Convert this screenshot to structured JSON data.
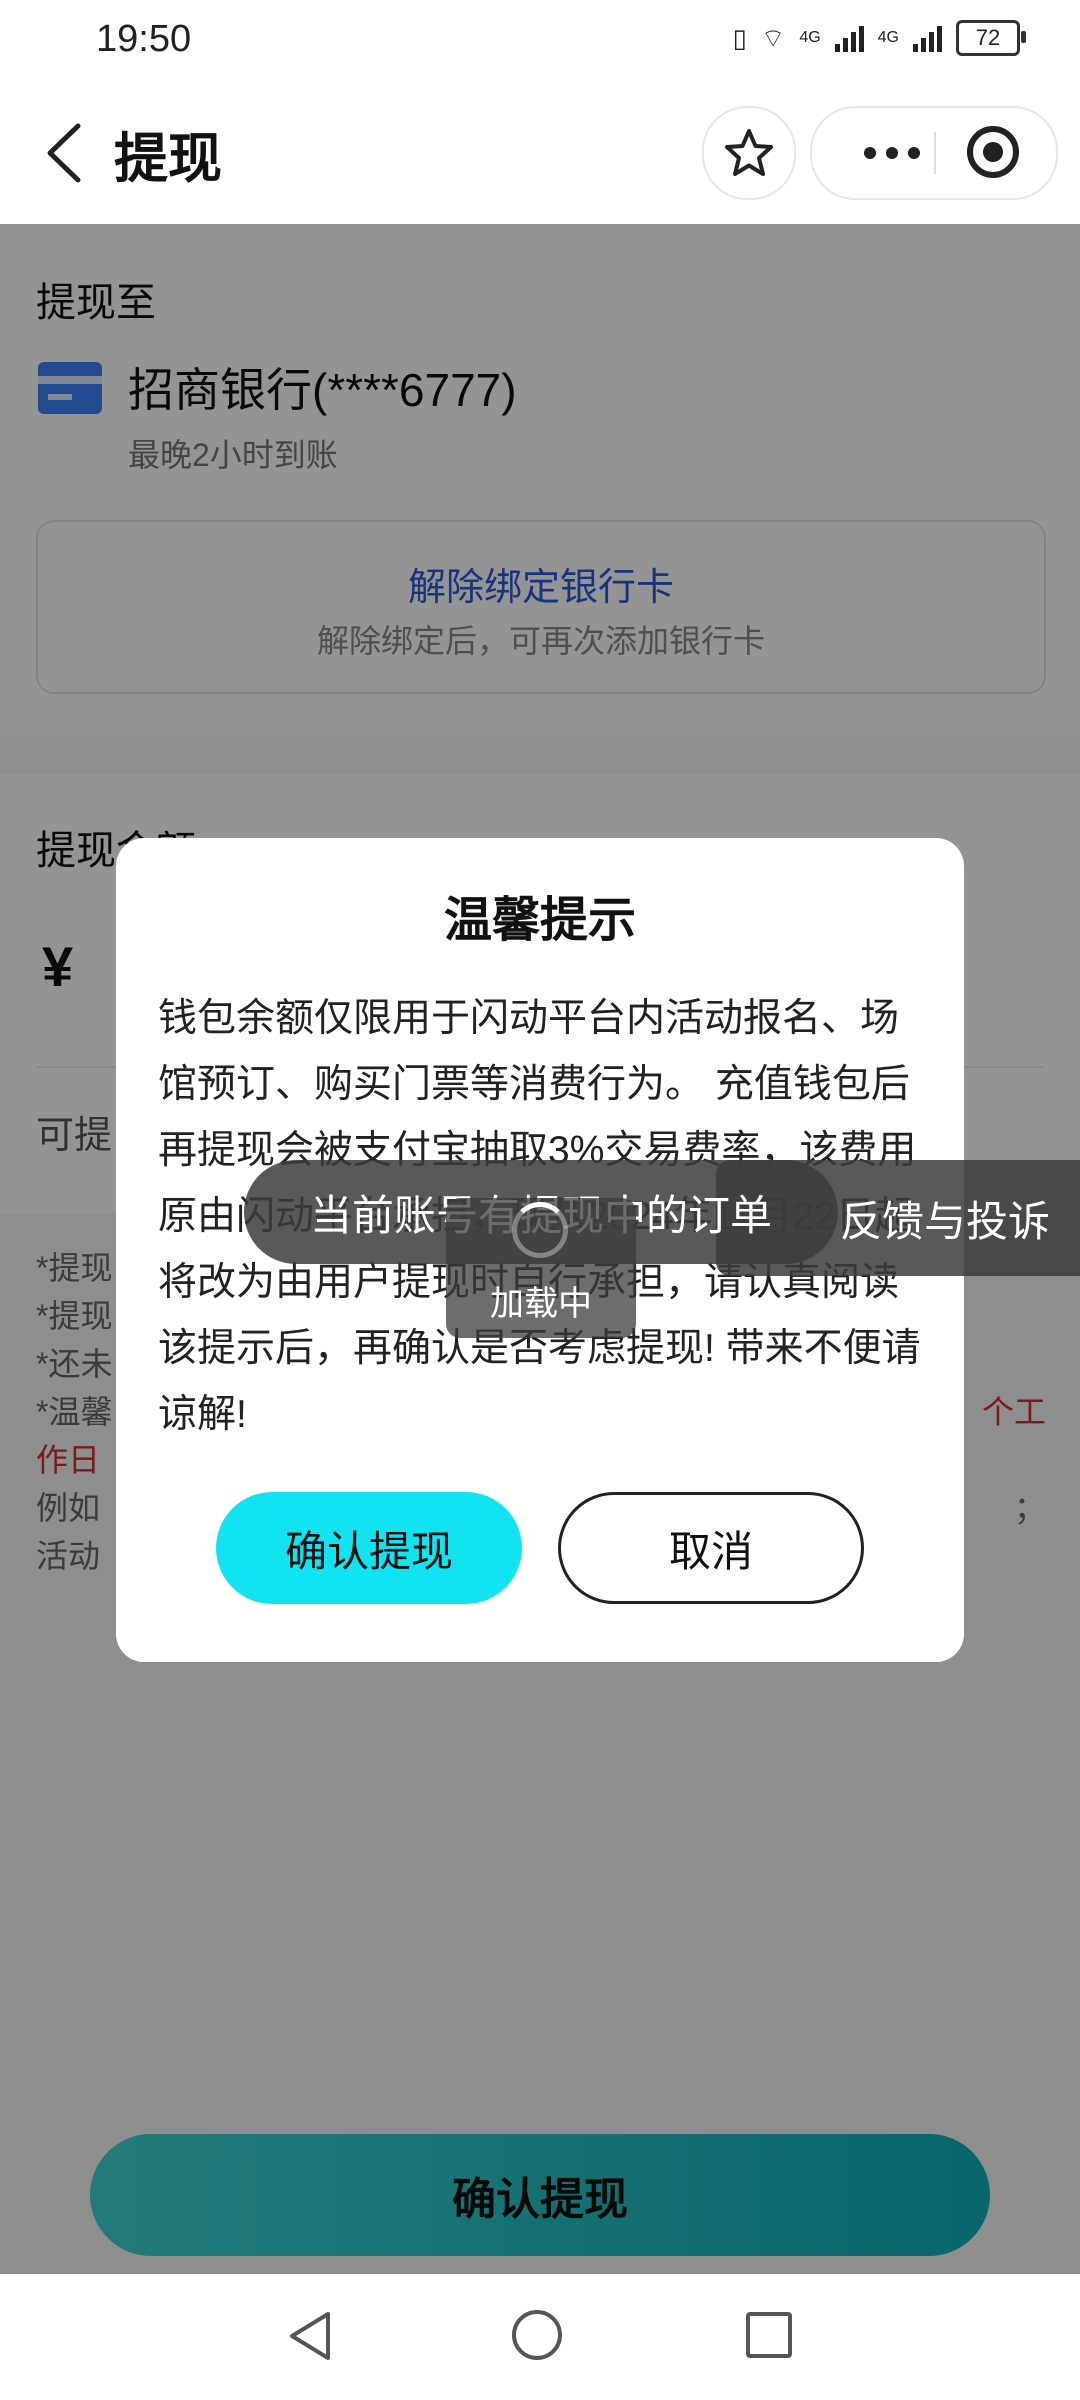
{
  "status_bar": {
    "time": "19:50",
    "net1": "4G",
    "net2": "4G",
    "battery": "72"
  },
  "header": {
    "title": "提现"
  },
  "withdraw_to": {
    "heading": "提现至",
    "bank_name": "招商银行(****6777)",
    "arrival": "最晚2小时到账",
    "unbind_title": "解除绑定银行卡",
    "unbind_desc": "解除绑定后，可再次添加银行卡"
  },
  "amount": {
    "heading": "提现金额",
    "currency": "¥",
    "available_prefix": "可提"
  },
  "notes": {
    "line1": "*提现",
    "line2": "*提现",
    "line3": "*还未",
    "line4_prefix": "*温馨",
    "line4_red_end": "个工",
    "line5_red": "作日",
    "line6_prefix": "例如",
    "line6_end": "；",
    "line7": "活动"
  },
  "bottom_button": {
    "label": "确认提现"
  },
  "dialog": {
    "title": "温馨提示",
    "body": "钱包余额仅限用于闪动平台内活动报名、场馆预订、购买门票等消费行为。 充值钱包后再提现会被支付宝抽取3%交易费率，该费用原由闪动平台承担，现从2024年11月22日起将改为由用户提现时自行承担，请认真阅读该提示后，再确认是否考虑提现! 带来不便请谅解!",
    "confirm_label": "确认提现",
    "cancel_label": "取消"
  },
  "toast": {
    "message": "当前账号有提现中的订单"
  },
  "feedback": {
    "label": "反馈与投诉"
  },
  "loading": {
    "label": "加载中"
  },
  "colors": {
    "accent": "#13e3f0",
    "link": "#2a5bd7",
    "warning": "#d32f2f"
  }
}
